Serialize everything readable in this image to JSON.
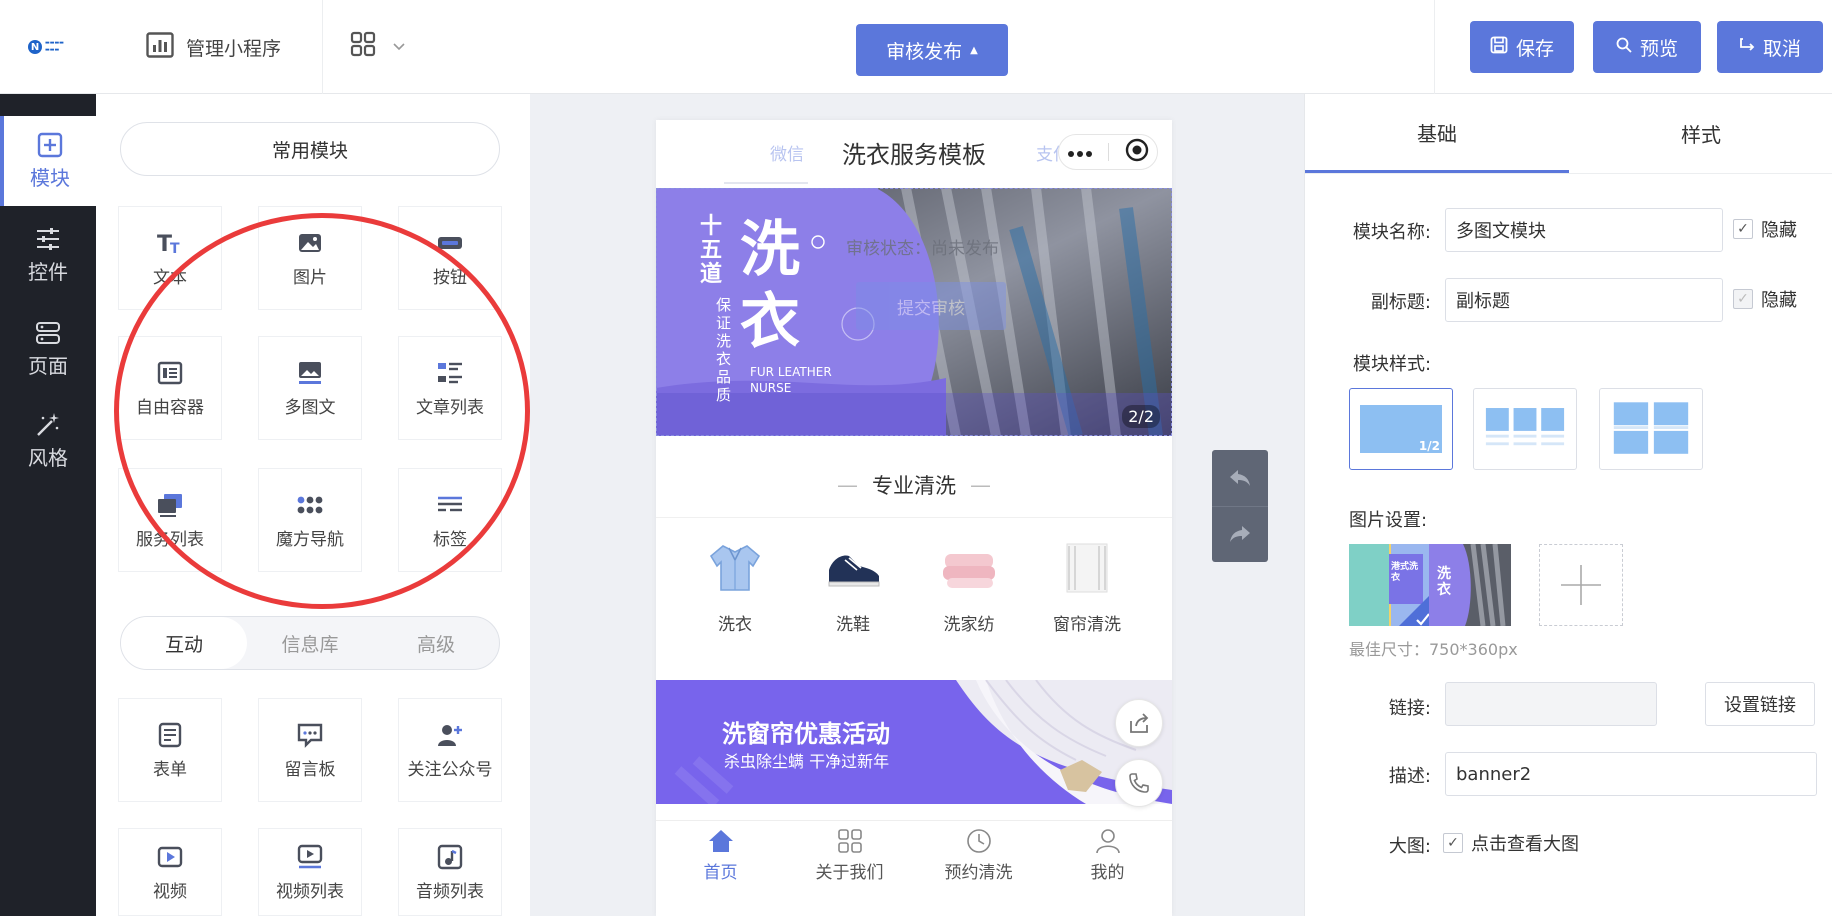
{
  "header": {
    "app_label": "管理小程序",
    "publish_label": "审核发布",
    "save_label": "保存",
    "preview_label": "预览",
    "cancel_label": "取消"
  },
  "leftnav": {
    "items": [
      {
        "label": "模块",
        "icon": "plus-square-icon",
        "active": true
      },
      {
        "label": "控件",
        "icon": "sliders-icon"
      },
      {
        "label": "页面",
        "icon": "server-icon"
      },
      {
        "label": "风格",
        "icon": "magic-wand-icon"
      }
    ]
  },
  "components": {
    "common_label": "常用模块",
    "common": [
      {
        "label": "文本",
        "icon": "text-icon"
      },
      {
        "label": "图片",
        "icon": "image-icon"
      },
      {
        "label": "按钮",
        "icon": "button-icon"
      },
      {
        "label": "自由容器",
        "icon": "container-icon"
      },
      {
        "label": "多图文",
        "icon": "multi-image-icon"
      },
      {
        "label": "文章列表",
        "icon": "article-list-icon"
      },
      {
        "label": "服务列表",
        "icon": "service-list-icon"
      },
      {
        "label": "魔方导航",
        "icon": "dots-grid-icon"
      },
      {
        "label": "标签",
        "icon": "tag-lines-icon"
      }
    ],
    "tabs": [
      "互动",
      "信息库",
      "高级"
    ],
    "interactive": [
      {
        "label": "表单",
        "icon": "form-icon"
      },
      {
        "label": "留言板",
        "icon": "message-board-icon"
      },
      {
        "label": "关注公众号",
        "icon": "follow-user-icon"
      },
      {
        "label": "视频",
        "icon": "video-icon"
      },
      {
        "label": "视频列表",
        "icon": "video-list-icon"
      },
      {
        "label": "音频列表",
        "icon": "audio-list-icon"
      }
    ]
  },
  "phone": {
    "title": "洗衣服务模板",
    "ghost_left": "微信",
    "ghost_right": "支付宝",
    "banner": {
      "vertical_title": "十五道",
      "big_chars": "洗衣",
      "slogan": "保证洗衣品质",
      "english": "FUR LEATHER NURSE",
      "review_status": "审核状态：尚未发布",
      "submit_review": "提交审核",
      "counter": "2/2"
    },
    "section_title": "专业清洗",
    "services": [
      {
        "label": "洗衣",
        "icon": "shirt-icon"
      },
      {
        "label": "洗鞋",
        "icon": "shoe-icon"
      },
      {
        "label": "洗家纺",
        "icon": "towel-icon"
      },
      {
        "label": "窗帘清洗",
        "icon": "curtain-icon"
      }
    ],
    "promo": {
      "title": "洗窗帘优惠活动",
      "subtitle": "杀虫除尘螨 干净过新年"
    },
    "tabbar": [
      {
        "label": "首页",
        "icon": "home-icon",
        "active": true
      },
      {
        "label": "关于我们",
        "icon": "grid-icon"
      },
      {
        "label": "预约清洗",
        "icon": "clock-icon"
      },
      {
        "label": "我的",
        "icon": "user-icon"
      }
    ]
  },
  "props": {
    "tabs": [
      "基础",
      "样式"
    ],
    "module_name_label": "模块名称:",
    "module_name_value": "多图文模块",
    "hide_label": "隐藏",
    "subtitle_label": "副标题:",
    "subtitle_value": "副标题",
    "style_label": "模块样式:",
    "style_badge": "1/2",
    "image_label": "图片设置:",
    "thumb1_text": "港式洗衣",
    "thumb2_text": "洗衣",
    "best_size": "最佳尺寸：750*360px",
    "link_label": "链接:",
    "link_value": "",
    "set_link_label": "设置链接",
    "desc_label": "描述:",
    "desc_value": "banner2",
    "big_label": "大图:",
    "big_option": "点击查看大图"
  },
  "colors": {
    "accent": "#5b77db",
    "sidebar": "#1f2229",
    "annotation": "#ea3b3b"
  }
}
